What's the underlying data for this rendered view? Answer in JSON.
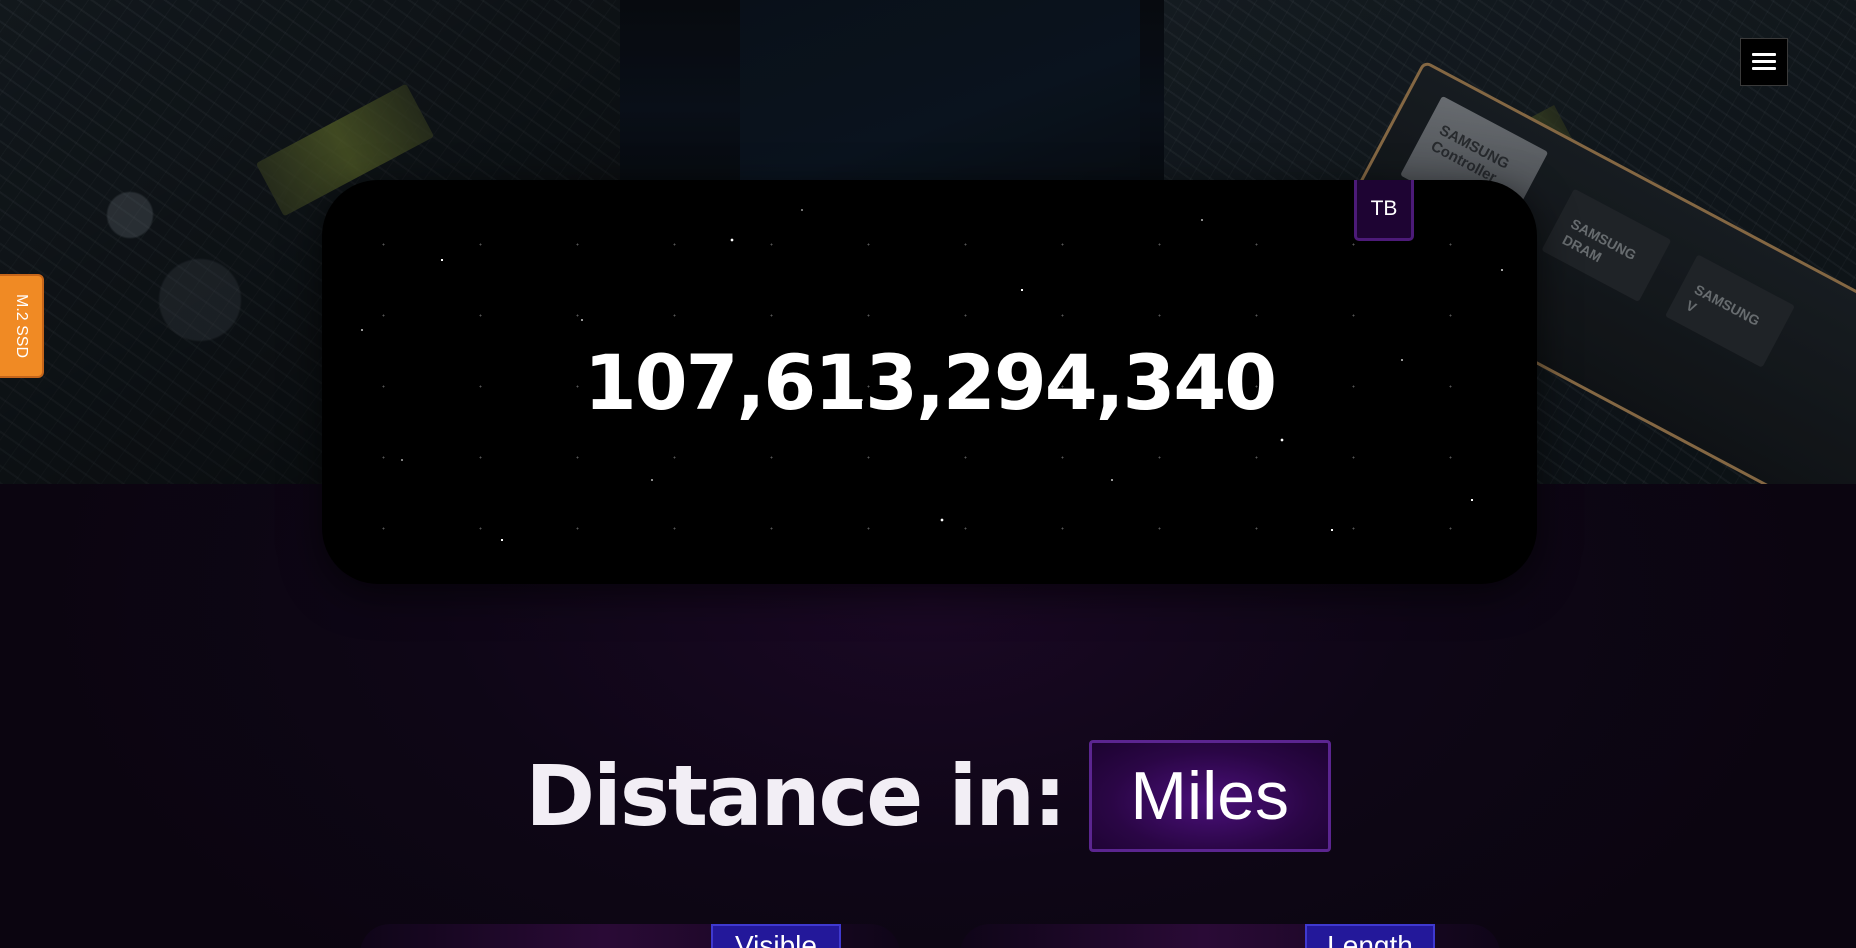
{
  "header": {
    "menu_icon": "hamburger-menu-icon"
  },
  "side_tab": {
    "label": "M.2 SSD",
    "color": "#f08a24"
  },
  "counter": {
    "value": "107,613,294,340",
    "unit": "TB"
  },
  "distance": {
    "label": "Distance in:",
    "selected_unit": "Miles"
  },
  "bottom_tabs": [
    {
      "label": "Visible"
    },
    {
      "label": "Length"
    }
  ],
  "hero_chip_labels": {
    "controller": "SAMSUNG\nController",
    "dram": "SAMSUNG\nDRAM",
    "nand": "SAMSUNG\nV"
  },
  "colors": {
    "accent_purple": "#4a0f7a",
    "badge_bg": "#1e0433",
    "tab_blue": "#23189a"
  }
}
